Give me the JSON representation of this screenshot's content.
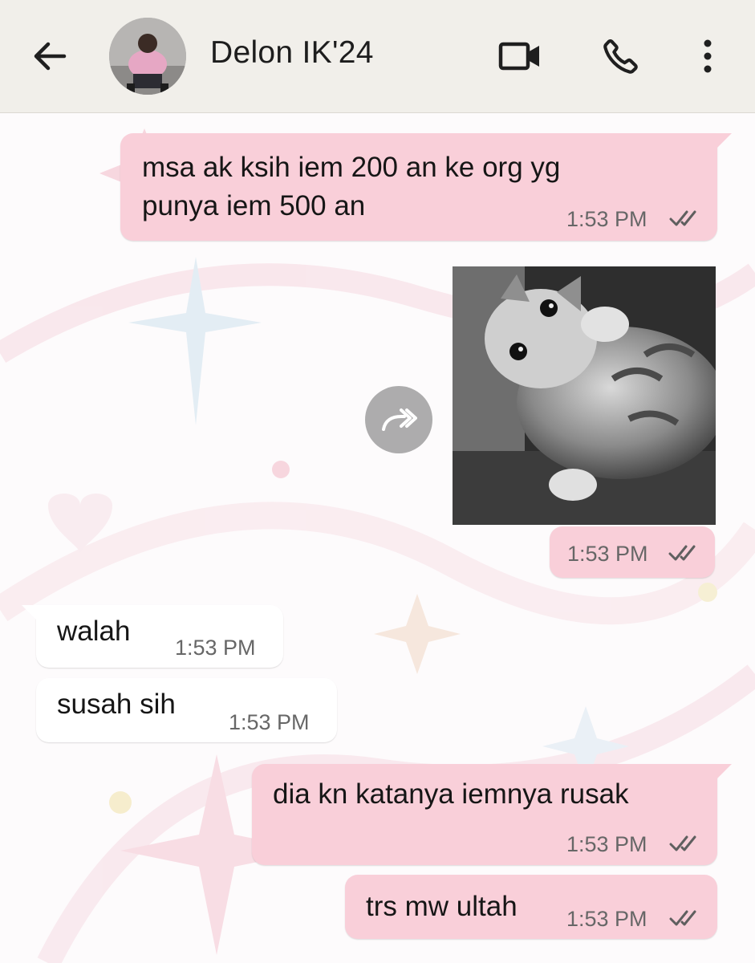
{
  "header": {
    "contact_name": "Delon IK'24",
    "back_icon": "arrow-left-icon",
    "video_icon": "video-camera-icon",
    "call_icon": "phone-icon",
    "menu_icon": "more-vertical-icon"
  },
  "messages": [
    {
      "direction": "out",
      "text_line1": "msa ak ksih iem 200 an ke org yg",
      "text_line2": "punya iem 500 an",
      "time": "1:53 PM",
      "status": "read"
    },
    {
      "direction": "out",
      "type": "image",
      "image": "kitten-photo",
      "time": "1:53 PM",
      "status": "read"
    },
    {
      "direction": "in",
      "text": "walah",
      "time": "1:53 PM"
    },
    {
      "direction": "in",
      "text": "susah sih",
      "time": "1:53 PM"
    },
    {
      "direction": "out",
      "text": "dia kn katanya iemnya rusak",
      "time": "1:53 PM",
      "status": "read"
    },
    {
      "direction": "out",
      "text": "trs mw ultah",
      "time": "1:53 PM",
      "status": "read"
    }
  ],
  "colors": {
    "header_bg": "#f1efea",
    "outgoing_bubble": "#f9cfd9",
    "incoming_bubble": "#ffffff",
    "read_ticks": "#5f5f5f"
  }
}
